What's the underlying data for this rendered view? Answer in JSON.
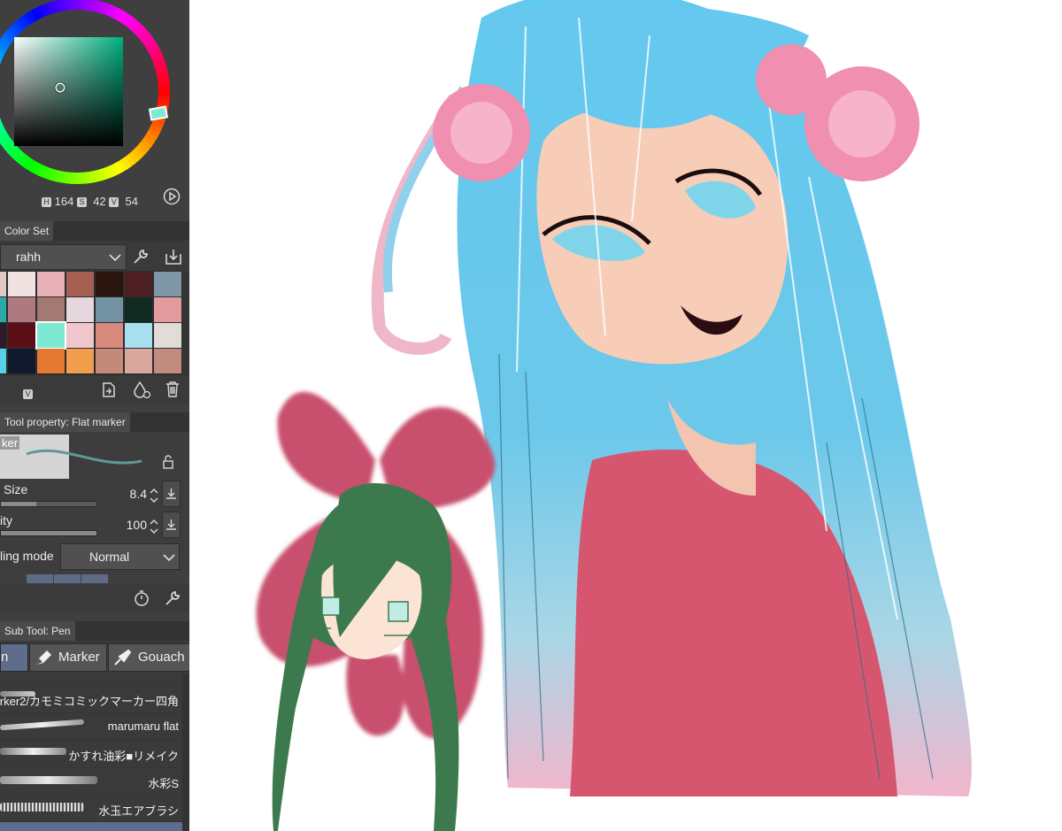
{
  "color_wheel": {
    "h_badge": "H",
    "h": "164",
    "s_badge": "S",
    "s": "42",
    "v_badge": "V",
    "v": "54",
    "current_color": "#7ee9d3"
  },
  "color_set": {
    "tab": "Color Set",
    "selected_set": "rahh",
    "v_badge": "V",
    "swatches": [
      [
        "#e0c7c2",
        "#f0e2e1",
        "#e7b0b6",
        "#a55f52",
        "#2a150e",
        "#4e1f23",
        "#7e96a6"
      ],
      [
        "#27a9a8",
        "#ad7a80",
        "#a37973",
        "#e6d7df",
        "#7393a5",
        "#112a22",
        "#e39ba0"
      ],
      [
        "#2d1a2b",
        "#5a0f17",
        "#7ee9d3",
        "#f0c7cd",
        "#d88b7c",
        "#a6dff0",
        "#e2dcd8"
      ],
      [
        "#57d0ec",
        "#101a2c",
        "#e57933",
        "#f19d4e",
        "#c48a79",
        "#d9a79e",
        "#c28b7f"
      ]
    ]
  },
  "tool_property": {
    "tab": "Tool property: Flat marker",
    "preview_label": "ker",
    "brush_size": {
      "label": "Size",
      "value": "8.4"
    },
    "opacity": {
      "label": "ity",
      "value": "100"
    },
    "blending_mode": {
      "label": "ling mode",
      "value": "Normal"
    }
  },
  "sub_tool": {
    "tab": "Sub Tool: Pen",
    "tabs": [
      {
        "label": "n"
      },
      {
        "label": "Marker"
      },
      {
        "label": "Gouach"
      }
    ],
    "brushes": [
      {
        "label": "larker2/カモミコミックマーカー四角"
      },
      {
        "label": "marumaru flat"
      },
      {
        "label": "かすれ油彩■リメイク"
      },
      {
        "label": "水彩S"
      },
      {
        "label": "水玉エアブラシ"
      }
    ]
  }
}
